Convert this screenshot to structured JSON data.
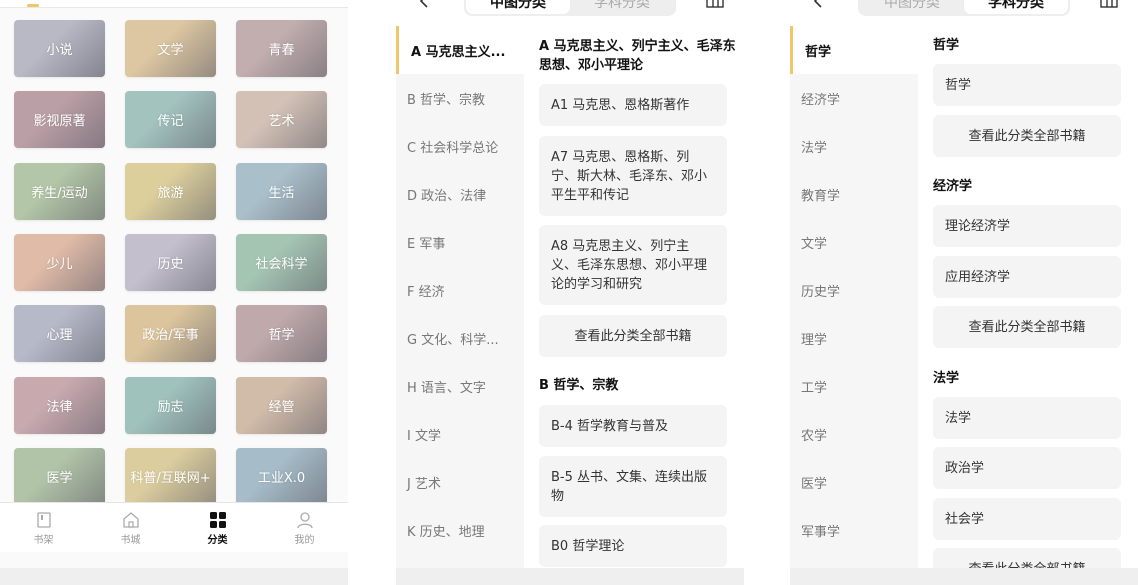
{
  "panel1": {
    "categories": [
      {
        "label": "小说",
        "color": "#b8b9c5"
      },
      {
        "label": "文学",
        "color": "#ddc7a2"
      },
      {
        "label": "青春",
        "color": "#c2aeae"
      },
      {
        "label": "影视原著",
        "color": "#bb9fa6"
      },
      {
        "label": "传记",
        "color": "#a3c3bf"
      },
      {
        "label": "艺术",
        "color": "#d3c1b6"
      },
      {
        "label": "养生/运动",
        "color": "#b3c6a7"
      },
      {
        "label": "旅游",
        "color": "#dccf9c"
      },
      {
        "label": "生活",
        "color": "#a9bfca"
      },
      {
        "label": "少儿",
        "color": "#e0bba8"
      },
      {
        "label": "历史",
        "color": "#c3bfcd"
      },
      {
        "label": "社会科学",
        "color": "#a5c5b3"
      },
      {
        "label": "心理",
        "color": "#b6b9c8"
      },
      {
        "label": "政治/军事",
        "color": "#dcc59d"
      },
      {
        "label": "哲学",
        "color": "#bfa9aa"
      },
      {
        "label": "法律",
        "color": "#c7a9ae"
      },
      {
        "label": "励志",
        "color": "#9fc2bd"
      },
      {
        "label": "经管",
        "color": "#d1bba9"
      },
      {
        "label": "医学",
        "color": "#b2c4a8"
      },
      {
        "label": "科普/互联网+",
        "color": "#dbcd9e"
      },
      {
        "label": "工业X.0",
        "color": "#a6bcc8"
      }
    ],
    "tabs": [
      {
        "label": "书架",
        "icon": "bookshelf-icon",
        "active": false
      },
      {
        "label": "书城",
        "icon": "home-icon",
        "active": false
      },
      {
        "label": "分类",
        "icon": "category-grid-icon",
        "active": true
      },
      {
        "label": "我的",
        "icon": "user-icon",
        "active": false
      }
    ]
  },
  "panel2": {
    "seg": {
      "left": "中图分类",
      "right": "学科分类",
      "selected": "left"
    },
    "sidebar": [
      "A 马克思主义、列宁主义、毛泽东思想、邓小平理论",
      "B 哲学、宗教",
      "C 社会科学总论",
      "D 政治、法律",
      "E 军事",
      "F 经济",
      "G 文化、科学、教育、体育",
      "H 语言、文字",
      "I 文学",
      "J 艺术",
      "K 历史、地理"
    ],
    "sidebar_display": [
      "A 马克思主义...",
      "B 哲学、宗教",
      "C 社会科学总论",
      "D 政治、法律",
      "E 军事",
      "F 经济",
      "G 文化、科学...",
      "H 语言、文字",
      "I 文学",
      "J 艺术",
      "K 历史、地理"
    ],
    "content": {
      "secA_title": "A 马克思主义、列宁主义、毛泽东思想、邓小平理论",
      "a1": "A1 马克思、恩格斯著作",
      "a7": "A7 马克思、恩格斯、列宁、斯大林、毛泽东、邓小平生平和传记",
      "a8": "A8 马克思主义、列宁主义、毛泽东思想、邓小平理论的学习和研究",
      "view_all": "查看此分类全部书籍",
      "secB_title": "B 哲学、宗教",
      "b4": "B-4 哲学教育与普及",
      "b5": "B-5 丛书、文集、连续出版物",
      "b0": "B0 哲学理论"
    }
  },
  "panel3": {
    "seg": {
      "left": "中图分类",
      "right": "学科分类",
      "selected": "right"
    },
    "sidebar": [
      "哲学",
      "经济学",
      "法学",
      "教育学",
      "文学",
      "历史学",
      "理学",
      "工学",
      "农学",
      "医学",
      "军事学"
    ],
    "content": {
      "s1_title": "哲学",
      "s1_c1": "哲学",
      "view_all": "查看此分类全部书籍",
      "s2_title": "经济学",
      "s2_c1": "理论经济学",
      "s2_c2": "应用经济学",
      "s3_title": "法学",
      "s3_c1": "法学",
      "s3_c2": "政治学",
      "s3_c3": "社会学"
    }
  }
}
